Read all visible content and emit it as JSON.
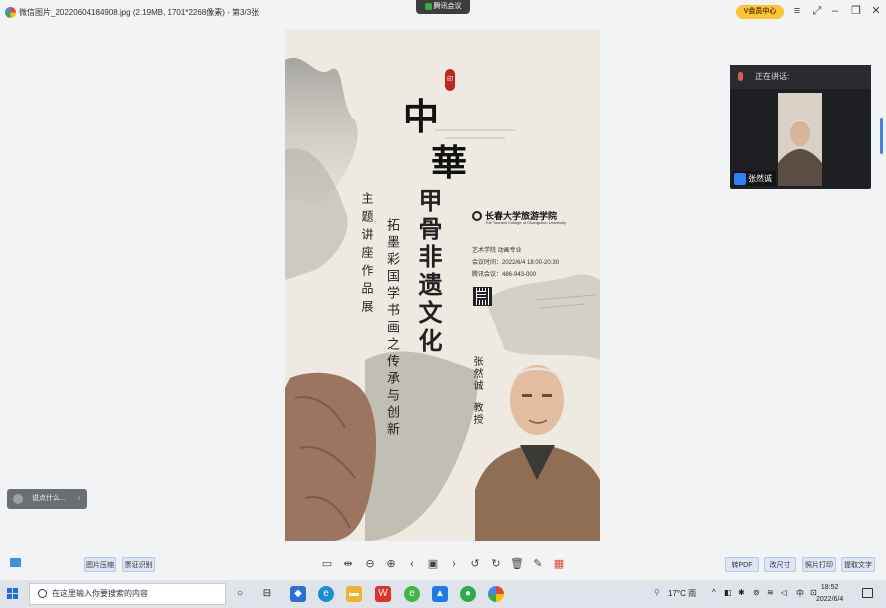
{
  "window": {
    "title": "微信图片_20220604184908.jpg (2.19MB, 1701*2268像素) - 第3/3张",
    "meeting_label": "腾讯会议",
    "vip_label": "V会员中心"
  },
  "poster": {
    "seal_text": "印",
    "title_chars": [
      "中",
      "華"
    ],
    "subtitle_chars": "甲骨非遗文化",
    "left_col1": "主题讲座作品展",
    "left_col2": "拓墨彩国学书画之传承与创新",
    "school_name_cn": "长春大学旅游学院",
    "school_name_en": "The Tourism College of Changchun University",
    "info_dept": "艺术学院 动画专业",
    "info_time": "会议时间：2022/6/4 18:00-20:30",
    "info_meeting": "腾讯会议：486-943-000",
    "speaker_name": "张然诚",
    "speaker_title": "教授"
  },
  "video_panel": {
    "header": "正在讲话:",
    "participant": "张然诚"
  },
  "comment_box": {
    "placeholder": "说点什么..."
  },
  "toolbar": {
    "compress": "图片压缩",
    "ocr": "票证识别",
    "to_pdf": "转PDF",
    "change_size": "改尺寸",
    "print_photo": "照片打印",
    "extract_text": "提取文字"
  },
  "taskbar": {
    "search_placeholder": "在这里输入你要搜索的内容",
    "weather": "17°C 雨",
    "ime": "中",
    "time": "18:52",
    "date": "2022/6/4"
  },
  "colors": {
    "accent": "#2f7ff5",
    "seal_red": "#c0281f",
    "vip_yellow": "#f9c531"
  }
}
